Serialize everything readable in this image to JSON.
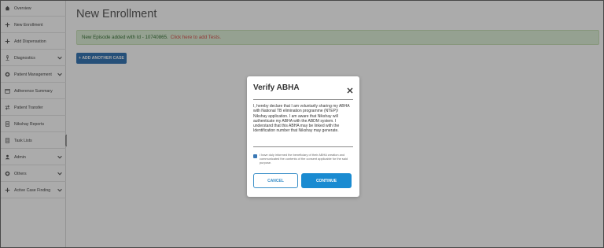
{
  "sidebar": {
    "items": [
      {
        "label": "Overview",
        "icon": "home-icon",
        "has_chevron": false
      },
      {
        "label": "New Enrollment",
        "icon": "plus-icon",
        "has_chevron": false
      },
      {
        "label": "Add Dispensation",
        "icon": "plus-icon",
        "has_chevron": false
      },
      {
        "label": "Diagnostics",
        "icon": "microscope-icon",
        "has_chevron": true
      },
      {
        "label": "Patient Management",
        "icon": "gear-icon",
        "has_chevron": true
      },
      {
        "label": "Adherence Summary",
        "icon": "calendar-icon",
        "has_chevron": false
      },
      {
        "label": "Patient Transfer",
        "icon": "transfer-icon",
        "has_chevron": false
      },
      {
        "label": "Nikshay Reports",
        "icon": "document-icon",
        "has_chevron": false
      },
      {
        "label": "Task Lists",
        "icon": "document-icon",
        "has_chevron": false
      },
      {
        "label": "Admin",
        "icon": "user-icon",
        "has_chevron": true
      },
      {
        "label": "Others",
        "icon": "gear-icon",
        "has_chevron": true
      },
      {
        "label": "Active Case Finding",
        "icon": "plus-icon",
        "has_chevron": true
      }
    ]
  },
  "main": {
    "title": "New Enrollment",
    "alert_text": "New Episode added with Id - 10740865.",
    "alert_link": "Click here to add Tests.",
    "add_case_label": "+ ADD ANOTHER CASE"
  },
  "modal": {
    "title": "Verify ABHA",
    "declaration": "I, hereby declare that I am voluntarily sharing my ABHA with National TB elimination programme (NTEP)/ Nikshay application. I am aware that Nikshay will authenticate my ABHA with the ABDM system. I understand that this ABHA may be linked with the Identification number that Nikshay may generate.",
    "consent": "I have duly informed the beneficiary of their ABHA creation and communicated the contents of the consent applicable for the said purpose.",
    "consent_checked": true,
    "cancel_label": "CANCEL",
    "continue_label": "CONTINUE"
  },
  "colors": {
    "primary": "#3a78b5",
    "continue": "#1a8bd1",
    "alert_bg": "#dff0d8",
    "alert_text": "#3c763d",
    "alert_link": "#d9534f"
  }
}
